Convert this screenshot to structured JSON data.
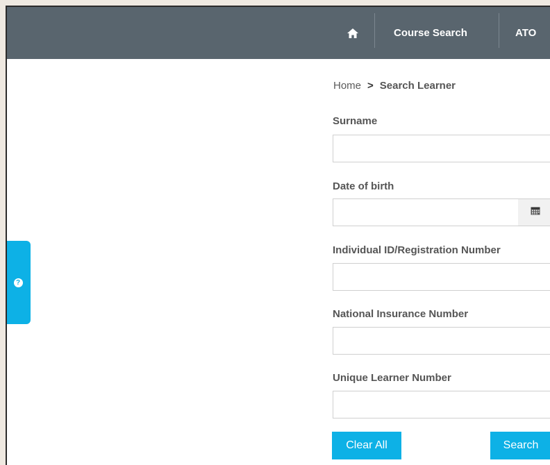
{
  "nav": {
    "home_icon": "home-icon",
    "items": [
      {
        "label": "Course Search"
      },
      {
        "label": "ATO"
      }
    ]
  },
  "help": {
    "icon": "question-circle-icon",
    "glyph": "?"
  },
  "breadcrumb": {
    "home": "Home",
    "separator": ">",
    "current": "Search Learner"
  },
  "form": {
    "surname": {
      "label": "Surname",
      "value": "",
      "placeholder": ""
    },
    "dob": {
      "label": "Date of birth",
      "value": "",
      "placeholder": "",
      "addon_icon": "calendar-icon"
    },
    "individual_id": {
      "label": "Individual ID/Registration Number",
      "value": "",
      "placeholder": ""
    },
    "ni_number": {
      "label": "National Insurance Number",
      "value": "",
      "placeholder": ""
    },
    "uln": {
      "label": "Unique Learner Number",
      "value": "",
      "placeholder": ""
    }
  },
  "buttons": {
    "clear_all": "Clear All",
    "search": "Search"
  },
  "colors": {
    "nav_bg": "#59656e",
    "accent": "#0db1e6",
    "page_bg": "#efe9e1"
  }
}
